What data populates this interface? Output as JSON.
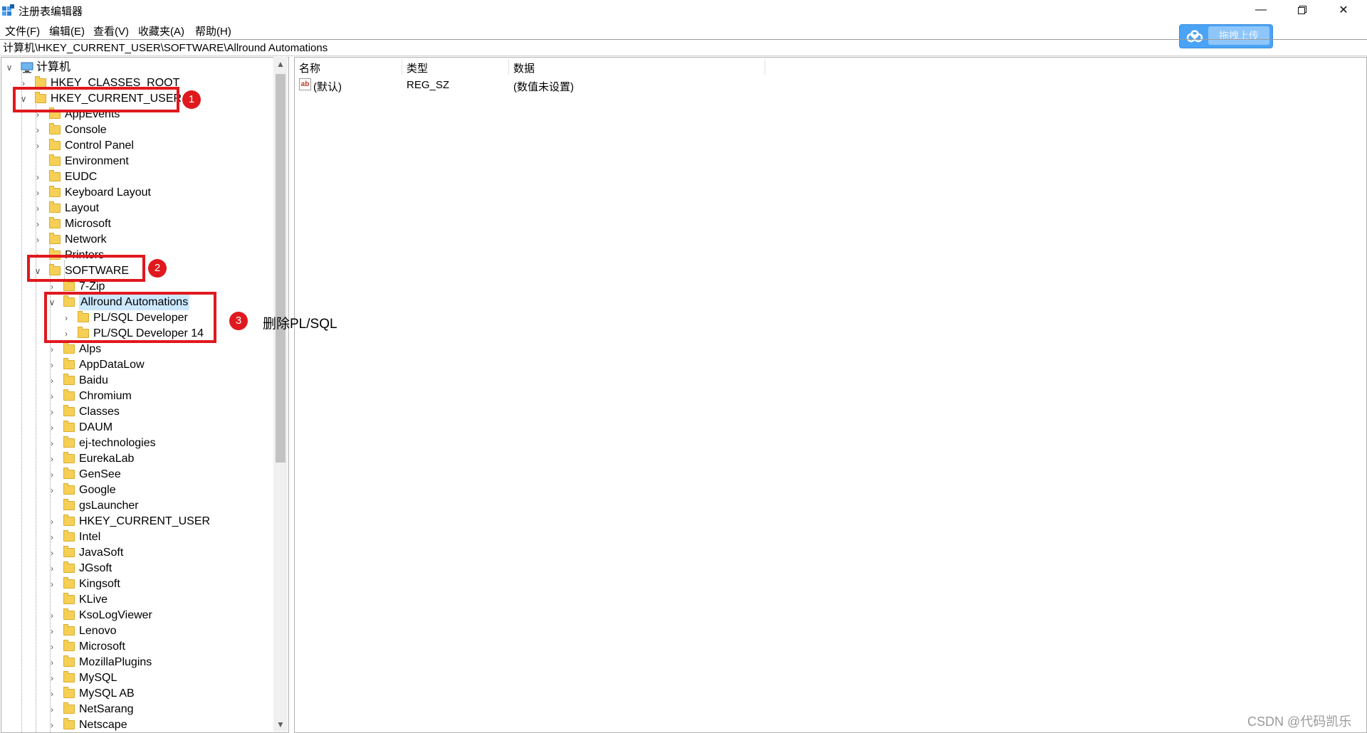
{
  "window": {
    "title": "注册表编辑器",
    "upload_button_label": "拖拽上传"
  },
  "menu": [
    "文件(F)",
    "编辑(E)",
    "查看(V)",
    "收藏夹(A)",
    "帮助(H)"
  ],
  "address": "计算机\\HKEY_CURRENT_USER\\SOFTWARE\\Allround Automations",
  "tree": {
    "root_label": "计算机",
    "nodes": [
      "HKEY_CLASSES_ROOT",
      "HKEY_CURRENT_USER",
      "AppEvents",
      "Console",
      "Control Panel",
      "Environment",
      "EUDC",
      "Keyboard Layout",
      "Layout",
      "Microsoft",
      "Network",
      "Printers",
      "SOFTWARE",
      "7-Zip",
      "Allround Automations",
      "PL/SQL Developer",
      "PL/SQL Developer 14",
      "Alps",
      "AppDataLow",
      "Baidu",
      "Chromium",
      "Classes",
      "DAUM",
      "ej-technologies",
      "EurekaLab",
      "GenSee",
      "Google",
      "gsLauncher",
      "HKEY_CURRENT_USER",
      "Intel",
      "JavaSoft",
      "JGsoft",
      "Kingsoft",
      "KLive",
      "KsoLogViewer",
      "Lenovo",
      "Microsoft",
      "MozillaPlugins",
      "MySQL",
      "MySQL AB",
      "NetSarang",
      "Netscape"
    ]
  },
  "list": {
    "columns": [
      "名称",
      "类型",
      "数据"
    ],
    "rows": [
      {
        "name": "(默认)",
        "type": "REG_SZ",
        "data": "(数值未设置)"
      }
    ]
  },
  "annotations": {
    "badge1": "1",
    "badge2": "2",
    "badge3": "3",
    "note": "删除PL/SQL"
  },
  "watermark": "CSDN @代码凯乐",
  "colors": {
    "annotation_red": "#e0191e",
    "selection_blue": "#cce8ff",
    "folder_yellow": "#f6cf57",
    "upload_blue": "#4aa3f5"
  }
}
